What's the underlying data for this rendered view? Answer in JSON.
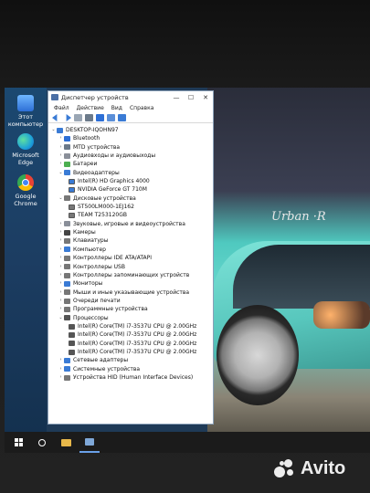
{
  "desktop": {
    "icons": [
      {
        "label": "Этот компьютер",
        "glyph": "pc-icon"
      },
      {
        "label": "Microsoft Edge",
        "glyph": "edge-icon"
      },
      {
        "label": "Google Chrome",
        "glyph": "chrome-icon"
      }
    ],
    "wallpaper_text": "Urban ·R"
  },
  "window": {
    "title": "Диспетчер устройств",
    "controls": {
      "minimize": "—",
      "maximize": "☐",
      "close": "✕"
    },
    "menu": [
      "Файл",
      "Действие",
      "Вид",
      "Справка"
    ],
    "tree": {
      "root": "DESKTOP-IQOHN97",
      "items": [
        {
          "label": "Bluetooth",
          "expanded": false,
          "color": "#2d6fd6"
        },
        {
          "label": "MTD устройства",
          "expanded": false,
          "color": "#6c7a8a"
        },
        {
          "label": "Аудиовходы и аудиовыходы",
          "expanded": false,
          "color": "#8a8f99"
        },
        {
          "label": "Батареи",
          "expanded": false,
          "color": "#4caf50"
        },
        {
          "label": "Видеоадаптеры",
          "expanded": true,
          "color": "#3a7bd5",
          "children": [
            "Intel(R) HD Graphics 4000",
            "NVIDIA GeForce GT 710M"
          ]
        },
        {
          "label": "Дисковые устройства",
          "expanded": true,
          "color": "#777777",
          "children": [
            "ST500LM000-1EJ162",
            "TEAM T253120GB"
          ]
        },
        {
          "label": "Звуковые, игровые и видеоустройства",
          "expanded": false,
          "color": "#8a8f99"
        },
        {
          "label": "Камеры",
          "expanded": false,
          "color": "#444444"
        },
        {
          "label": "Клавиатуры",
          "expanded": false,
          "color": "#777777"
        },
        {
          "label": "Компьютер",
          "expanded": false,
          "color": "#3a7bd5"
        },
        {
          "label": "Контроллеры IDE ATA/ATAPI",
          "expanded": false,
          "color": "#777777"
        },
        {
          "label": "Контроллеры USB",
          "expanded": false,
          "color": "#777777"
        },
        {
          "label": "Контроллеры запоминающих устройств",
          "expanded": false,
          "color": "#777777"
        },
        {
          "label": "Мониторы",
          "expanded": false,
          "color": "#3a7bd5"
        },
        {
          "label": "Мыши и иные указывающие устройства",
          "expanded": false,
          "color": "#777777"
        },
        {
          "label": "Очереди печати",
          "expanded": false,
          "color": "#777777"
        },
        {
          "label": "Программные устройства",
          "expanded": false,
          "color": "#777777"
        },
        {
          "label": "Процессоры",
          "expanded": true,
          "color": "#555555",
          "children": [
            "Intel(R) Core(TM) i7-3537U CPU @ 2.00GHz",
            "Intel(R) Core(TM) i7-3537U CPU @ 2.00GHz",
            "Intel(R) Core(TM) i7-3537U CPU @ 2.00GHz",
            "Intel(R) Core(TM) i7-3537U CPU @ 2.00GHz"
          ]
        },
        {
          "label": "Сетевые адаптеры",
          "expanded": false,
          "color": "#3a7bd5"
        },
        {
          "label": "Системные устройства",
          "expanded": false,
          "color": "#3a7bd5"
        },
        {
          "label": "Устройства HID (Human Interface Devices)",
          "expanded": false,
          "color": "#777777"
        }
      ]
    }
  },
  "taskbar": {
    "items": [
      "start-icon",
      "search-icon",
      "file-explorer-icon",
      "device-manager-icon"
    ]
  },
  "watermark": {
    "text": "Avito"
  }
}
